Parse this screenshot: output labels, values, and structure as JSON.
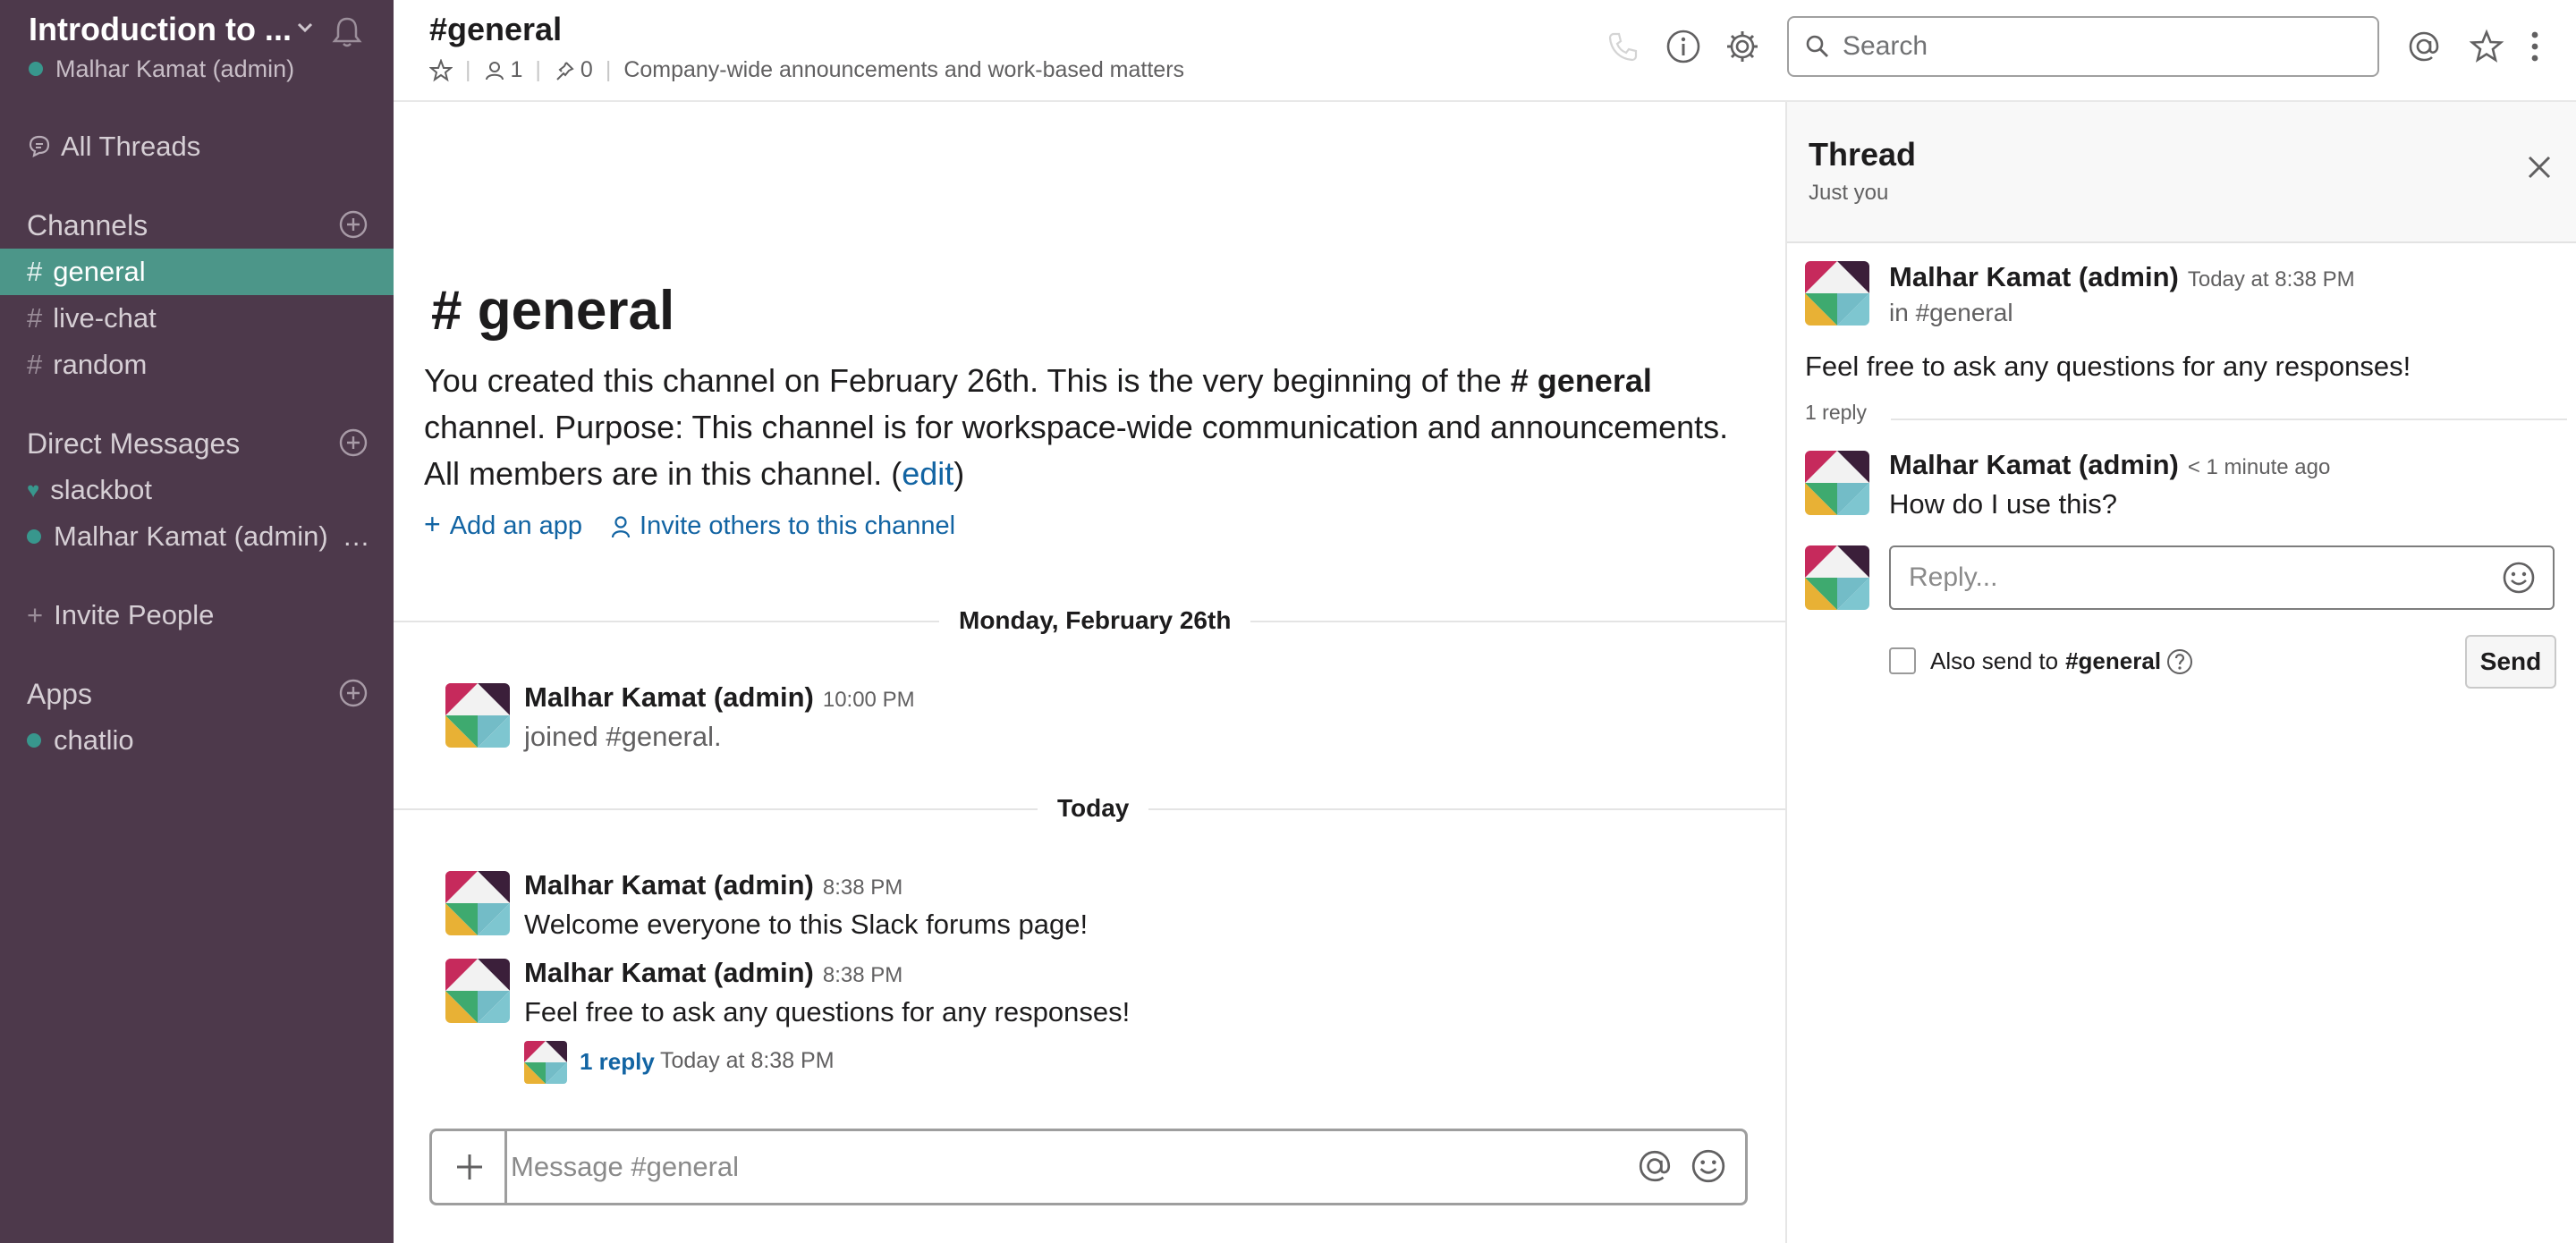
{
  "workspace": {
    "name": "Introduction to ...",
    "user": "Malhar Kamat (admin)"
  },
  "sidebar": {
    "all_threads": "All Threads",
    "channels_heading": "Channels",
    "channels": [
      "general",
      "live-chat",
      "random"
    ],
    "active_channel": "general",
    "dm_heading": "Direct Messages",
    "dms": [
      "slackbot",
      "Malhar Kamat (admin)"
    ],
    "invite": "Invite People",
    "apps_heading": "Apps",
    "apps": [
      "chatlio"
    ],
    "colors": {
      "background": "#4d394b",
      "active": "#4c9689",
      "presence": "#38978d"
    }
  },
  "header": {
    "channel": "#general",
    "members": "1",
    "pins": "0",
    "topic": "Company-wide announcements and work-based matters",
    "search_placeholder": "Search"
  },
  "intro": {
    "title": "# general",
    "text_1": "You created this channel on February 26th. This is the very beginning of the ",
    "channel_ref": "# general",
    "text_2": " channel. Purpose: This channel is for workspace-wide communication and announcements. All members are in this channel. (",
    "edit": "edit",
    "text_3": ")",
    "add_app": "Add an app",
    "invite_others": "Invite others to this channel"
  },
  "messages": {
    "day_1": "Monday, February 26th",
    "msg1": {
      "name": "Malhar Kamat (admin)",
      "time": "10:00 PM",
      "text": "joined #general."
    },
    "day_2": "Today",
    "msg2": {
      "name": "Malhar Kamat (admin)",
      "time": "8:38 PM",
      "text": "Welcome everyone to this Slack forums page!"
    },
    "msg3": {
      "name": "Malhar Kamat (admin)",
      "time": "8:38 PM",
      "text": "Feel free to ask any questions for any responses!"
    },
    "reply_count": "1 reply",
    "reply_time": "Today at 8:38 PM"
  },
  "composer": {
    "placeholder": "Message #general"
  },
  "thread": {
    "title": "Thread",
    "subtitle": "Just you",
    "parent": {
      "name": "Malhar Kamat (admin)",
      "time": "Today at 8:38 PM",
      "channel": "in #general",
      "text": "Feel free to ask any questions for any responses!"
    },
    "reply_count": "1 reply",
    "reply": {
      "name": "Malhar Kamat (admin)",
      "time": "< 1 minute ago",
      "text": "How do I use this?"
    },
    "reply_placeholder": "Reply...",
    "also_send_prefix": "Also send to",
    "also_send_channel": "#general",
    "send": "Send"
  }
}
